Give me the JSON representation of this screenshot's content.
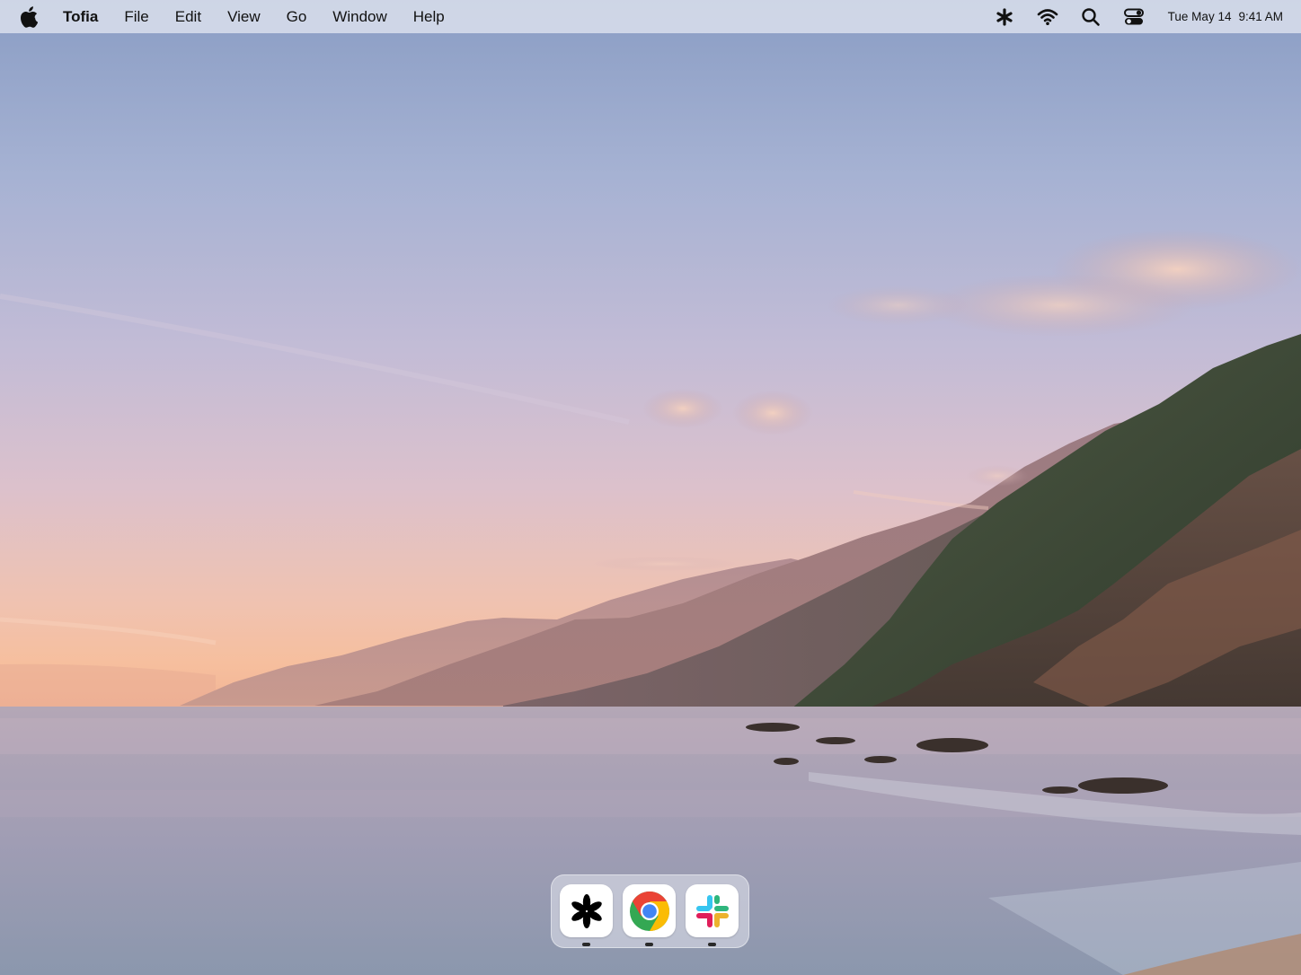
{
  "menubar": {
    "app_name": "Tofia",
    "menus": [
      "File",
      "Edit",
      "View",
      "Go",
      "Window",
      "Help"
    ],
    "status_icons": [
      "asterisk-icon",
      "wifi-icon",
      "search-icon",
      "control-center-icon"
    ],
    "clock": {
      "date": "Tue May 14",
      "time": "9:41 AM"
    }
  },
  "dock": {
    "apps": [
      {
        "icon": "asterisk-app-icon",
        "running": true
      },
      {
        "icon": "chrome-icon",
        "running": true
      },
      {
        "icon": "slack-icon",
        "running": true
      }
    ]
  },
  "colors": {
    "chrome_red": "#ea4335",
    "chrome_green": "#34a853",
    "chrome_yellow": "#fbbc05",
    "chrome_blue": "#4285f4",
    "slack_blue": "#36c5f0",
    "slack_green": "#2eb67d",
    "slack_yellow": "#ecb22e",
    "slack_red": "#e01e5a"
  }
}
